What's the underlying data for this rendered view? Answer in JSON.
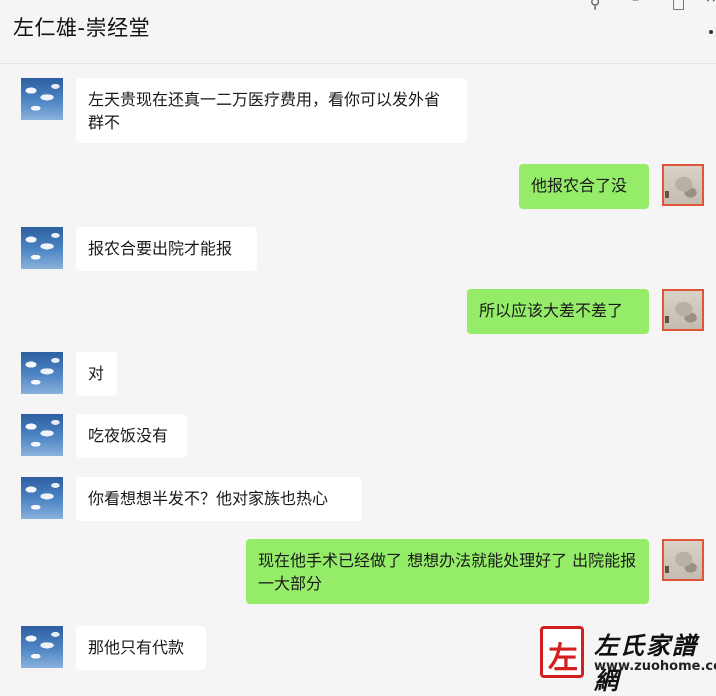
{
  "window": {
    "title": "左仁雄-崇经堂"
  },
  "icons": {
    "pin": "pin-icon",
    "minimize": "minimize-icon",
    "maximize": "maximize-icon",
    "close": "close-icon",
    "more": "more-icon"
  },
  "messages": [
    {
      "side": "in",
      "text": "左天贵现在还真一二万医疗费用，看你可以发外省群不"
    },
    {
      "side": "out",
      "text": "他报农合了没"
    },
    {
      "side": "in",
      "text": "报农合要出院才能报"
    },
    {
      "side": "out",
      "text": "所以应该大差不差了"
    },
    {
      "side": "in",
      "text": "对"
    },
    {
      "side": "in",
      "text": "吃夜饭没有"
    },
    {
      "side": "in",
      "text": "你看想想半发不？他对家族也热心"
    },
    {
      "side": "out",
      "text": "现在他手术已经做了 想想办法就能处理好了 出院能报一大部分"
    },
    {
      "side": "in",
      "text": "那他只有代款"
    }
  ],
  "colors": {
    "incoming_bubble": "#ffffff",
    "outgoing_bubble": "#95ec69",
    "background": "#f5f5f5"
  },
  "watermark": {
    "brand": "左氏家譜網",
    "url": "www.zuohome.com"
  }
}
